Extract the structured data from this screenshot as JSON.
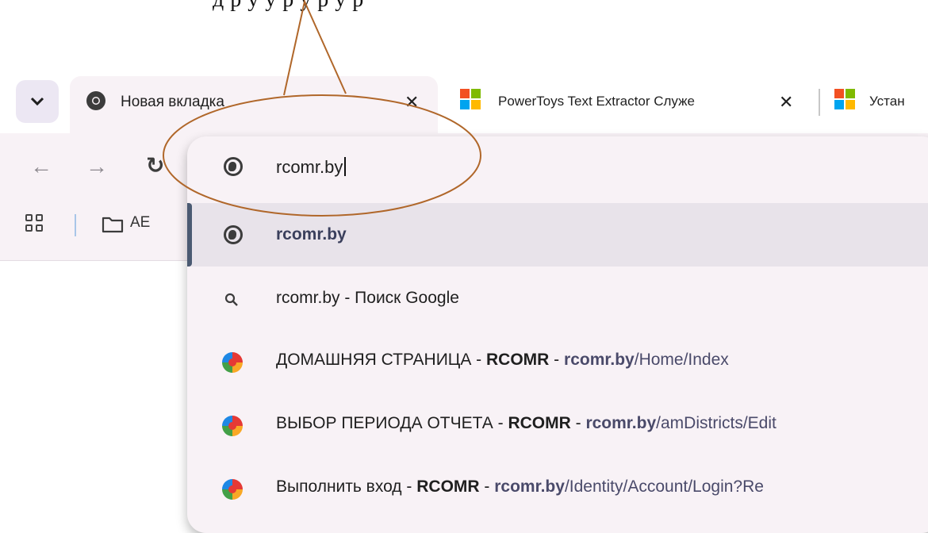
{
  "annotation": {
    "caption": "д р у у р у р у р"
  },
  "tabs": [
    {
      "title": "Новая вкладка",
      "active": true
    },
    {
      "title": "PowerToys Text Extractor Служе",
      "active": false
    },
    {
      "title": "Устан",
      "active": false
    }
  ],
  "bookmarks": {
    "folder_label": "AE"
  },
  "omnibox": {
    "input_value": "rcomr.by",
    "suggestions": [
      {
        "type": "globe",
        "text": "rcomr.by",
        "selected": true
      },
      {
        "type": "search",
        "text": "rcomr.by",
        "suffix": " - Поиск Google"
      },
      {
        "type": "history",
        "title": "ДОМАШНЯЯ СТРАНИЦА",
        "site": "RCOMR",
        "domain": "rcomr.by",
        "path": "/Home/Index"
      },
      {
        "type": "history",
        "title": "ВЫБОР ПЕРИОДА ОТЧЕТА",
        "site": "RCOMR",
        "domain": "rcomr.by",
        "path": "/amDistricts/Edit"
      },
      {
        "type": "history",
        "title": "Выполнить вход",
        "site": "RCOMR",
        "domain": "rcomr.by",
        "path": "/Identity/Account/Login?Re"
      }
    ]
  },
  "separator": " - ",
  "colors": {
    "panel": "#f8f2f6",
    "selected_row": "#e8e3ea",
    "annotation_stroke": "#b0672a"
  }
}
